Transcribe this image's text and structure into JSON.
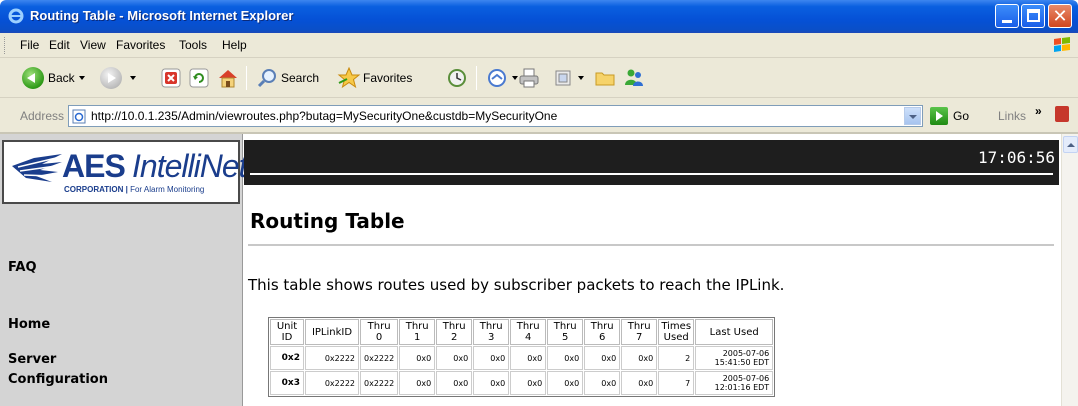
{
  "window": {
    "title": "Routing Table - Microsoft Internet Explorer"
  },
  "menu": {
    "items": [
      "File",
      "Edit",
      "View",
      "Favorites",
      "Tools",
      "Help"
    ]
  },
  "toolbar": {
    "back_label": "Back",
    "search_label": "Search",
    "favorites_label": "Favorites"
  },
  "address": {
    "label": "Address",
    "url": "http://10.0.1.235/Admin/viewroutes.php?butag=MySecurityOne&custdb=MySecurityOne",
    "go_label": "Go",
    "links_label": "Links",
    "links_chevron": "»"
  },
  "logo": {
    "aes": "AES",
    "intellinet": "IntelliNet",
    "corporation": "CORPORATION",
    "tagline": "For Alarm Monitoring"
  },
  "sidebar": {
    "items": [
      "FAQ",
      "Home",
      "Server Configuration"
    ]
  },
  "header": {
    "clock": "17:06:56"
  },
  "content": {
    "title": "Routing Table",
    "intro": "This table shows routes used by subscriber packets to reach the IPLink."
  },
  "table": {
    "headers": [
      "Unit ID",
      "IPLinkID",
      "Thru 0",
      "Thru 1",
      "Thru 2",
      "Thru 3",
      "Thru 4",
      "Thru 5",
      "Thru 6",
      "Thru 7",
      "Times Used",
      "Last Used"
    ],
    "rows": [
      {
        "unit_id": "0x2",
        "iplink": "0x2222",
        "thru0": "0x2222",
        "thru1": "0x0",
        "thru2": "0x0",
        "thru3": "0x0",
        "thru4": "0x0",
        "thru5": "0x0",
        "thru6": "0x0",
        "thru7": "0x0",
        "times": "2",
        "last_date": "2005-07-06",
        "last_time": "15:41:50 EDT"
      },
      {
        "unit_id": "0x3",
        "iplink": "0x2222",
        "thru0": "0x2222",
        "thru1": "0x0",
        "thru2": "0x0",
        "thru3": "0x0",
        "thru4": "0x0",
        "thru5": "0x0",
        "thru6": "0x0",
        "thru7": "0x0",
        "times": "7",
        "last_date": "2005-07-06",
        "last_time": "12:01:16 EDT"
      }
    ]
  },
  "colors": {
    "titlebar": "#0551d6",
    "chrome": "#ece9d8",
    "sidebar": "#d4d4d4",
    "header_band": "#1e1e1e",
    "logo_blue": "#1a3d8c"
  }
}
